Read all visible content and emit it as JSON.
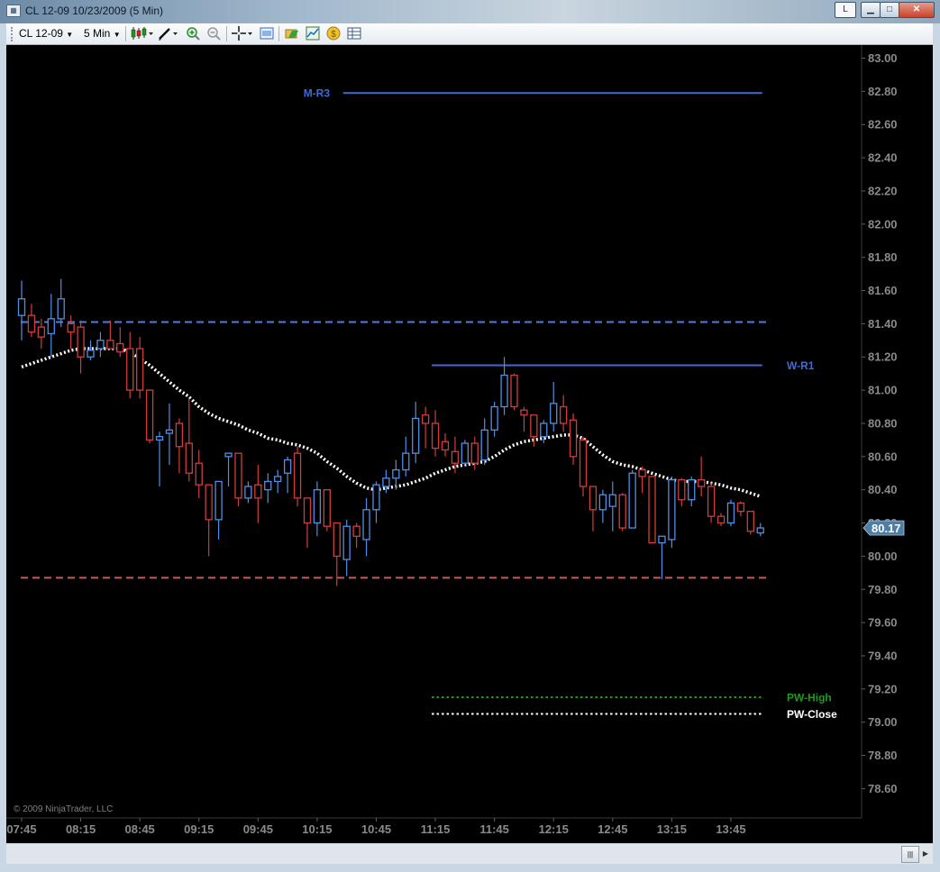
{
  "window": {
    "title": "CL 12-09  10/23/2009 (5 Min)",
    "icon": "chart-window-icon",
    "lock_button": "L"
  },
  "toolbar": {
    "instrument": "CL 12-09",
    "interval": "5 Min",
    "icons": [
      "candlestick-icon",
      "pencil-icon",
      "zoom-in-icon",
      "zoom-out-icon",
      "crosshair-icon",
      "properties-icon",
      "folder-icon",
      "chart-trader-icon",
      "coin-icon",
      "table-icon"
    ]
  },
  "chart": {
    "copyright": "© 2009 NinjaTrader, LLC",
    "last_price_label": "80.17"
  },
  "colors": {
    "background": "#000000",
    "up_candle": "#4f8fe6",
    "down_candle": "#d13d3d",
    "axis_text": "#8a8a8a",
    "resistance_line": "#3e6bd6",
    "support_line": "#c85a5a",
    "pw_high": "#1f9b1f",
    "pw_close": "#ffffff",
    "ma": "#ffffff"
  },
  "chart_data": {
    "type": "candlestick",
    "instrument": "CL 12-09",
    "interval": "5 Min",
    "date": "10/23/2009",
    "ylim": [
      78.5,
      83.05
    ],
    "y_ticks": [
      83.0,
      82.8,
      82.6,
      82.4,
      82.2,
      82.0,
      81.8,
      81.6,
      81.4,
      81.2,
      81.0,
      80.8,
      80.6,
      80.4,
      80.2,
      80.0,
      79.8,
      79.6,
      79.4,
      79.2,
      79.0,
      78.8,
      78.6
    ],
    "x_tick_labels": [
      "07:45",
      "08:15",
      "08:45",
      "09:15",
      "09:45",
      "10:15",
      "10:45",
      "11:15",
      "11:45",
      "12:15",
      "12:45",
      "13:15",
      "13:45"
    ],
    "start_time": "07:45",
    "bar_minutes": 5,
    "last_price": 80.17,
    "candles": [
      {
        "o": 81.45,
        "h": 81.66,
        "l": 81.3,
        "c": 81.55
      },
      {
        "o": 81.45,
        "h": 81.52,
        "l": 81.32,
        "c": 81.35
      },
      {
        "o": 81.38,
        "h": 81.43,
        "l": 81.25,
        "c": 81.32
      },
      {
        "o": 81.34,
        "h": 81.58,
        "l": 81.2,
        "c": 81.43
      },
      {
        "o": 81.43,
        "h": 81.67,
        "l": 81.38,
        "c": 81.55
      },
      {
        "o": 81.4,
        "h": 81.45,
        "l": 81.25,
        "c": 81.35
      },
      {
        "o": 81.38,
        "h": 81.42,
        "l": 81.1,
        "c": 81.2
      },
      {
        "o": 81.2,
        "h": 81.3,
        "l": 81.18,
        "c": 81.24
      },
      {
        "o": 81.25,
        "h": 81.35,
        "l": 81.2,
        "c": 81.3
      },
      {
        "o": 81.3,
        "h": 81.42,
        "l": 81.25,
        "c": 81.25
      },
      {
        "o": 81.28,
        "h": 81.38,
        "l": 81.2,
        "c": 81.23
      },
      {
        "o": 81.25,
        "h": 81.35,
        "l": 80.95,
        "c": 81.0
      },
      {
        "o": 81.25,
        "h": 81.32,
        "l": 80.95,
        "c": 81.0
      },
      {
        "o": 81.0,
        "h": 81.0,
        "l": 80.68,
        "c": 80.7
      },
      {
        "o": 80.7,
        "h": 80.75,
        "l": 80.42,
        "c": 80.72
      },
      {
        "o": 80.74,
        "h": 80.92,
        "l": 80.55,
        "c": 80.76
      },
      {
        "o": 80.8,
        "h": 80.83,
        "l": 80.5,
        "c": 80.66
      },
      {
        "o": 80.68,
        "h": 80.95,
        "l": 80.45,
        "c": 80.5
      },
      {
        "o": 80.56,
        "h": 80.64,
        "l": 80.35,
        "c": 80.43
      },
      {
        "o": 80.43,
        "h": 80.43,
        "l": 80.0,
        "c": 80.22
      },
      {
        "o": 80.22,
        "h": 80.45,
        "l": 80.1,
        "c": 80.45
      },
      {
        "o": 80.6,
        "h": 80.62,
        "l": 80.42,
        "c": 80.62
      },
      {
        "o": 80.62,
        "h": 80.62,
        "l": 80.3,
        "c": 80.35
      },
      {
        "o": 80.35,
        "h": 80.45,
        "l": 80.32,
        "c": 80.42
      },
      {
        "o": 80.43,
        "h": 80.55,
        "l": 80.2,
        "c": 80.35
      },
      {
        "o": 80.4,
        "h": 80.5,
        "l": 80.32,
        "c": 80.45
      },
      {
        "o": 80.45,
        "h": 80.52,
        "l": 80.38,
        "c": 80.48
      },
      {
        "o": 80.5,
        "h": 80.6,
        "l": 80.38,
        "c": 80.58
      },
      {
        "o": 80.62,
        "h": 80.66,
        "l": 80.3,
        "c": 80.35
      },
      {
        "o": 80.35,
        "h": 80.35,
        "l": 80.05,
        "c": 80.2
      },
      {
        "o": 80.2,
        "h": 80.45,
        "l": 80.12,
        "c": 80.4
      },
      {
        "o": 80.4,
        "h": 80.4,
        "l": 80.15,
        "c": 80.18
      },
      {
        "o": 80.2,
        "h": 80.2,
        "l": 79.82,
        "c": 80.0
      },
      {
        "o": 79.98,
        "h": 80.22,
        "l": 79.88,
        "c": 80.18
      },
      {
        "o": 80.18,
        "h": 80.2,
        "l": 80.05,
        "c": 80.12
      },
      {
        "o": 80.1,
        "h": 80.35,
        "l": 80.0,
        "c": 80.28
      },
      {
        "o": 80.28,
        "h": 80.45,
        "l": 80.2,
        "c": 80.43
      },
      {
        "o": 80.42,
        "h": 80.52,
        "l": 80.38,
        "c": 80.47
      },
      {
        "o": 80.47,
        "h": 80.58,
        "l": 80.4,
        "c": 80.52
      },
      {
        "o": 80.52,
        "h": 80.72,
        "l": 80.48,
        "c": 80.62
      },
      {
        "o": 80.62,
        "h": 80.93,
        "l": 80.56,
        "c": 80.83
      },
      {
        "o": 80.85,
        "h": 80.9,
        "l": 80.65,
        "c": 80.8
      },
      {
        "o": 80.8,
        "h": 80.88,
        "l": 80.6,
        "c": 80.65
      },
      {
        "o": 80.69,
        "h": 80.74,
        "l": 80.6,
        "c": 80.64
      },
      {
        "o": 80.63,
        "h": 80.72,
        "l": 80.5,
        "c": 80.56
      },
      {
        "o": 80.56,
        "h": 80.7,
        "l": 80.55,
        "c": 80.68
      },
      {
        "o": 80.68,
        "h": 80.72,
        "l": 80.52,
        "c": 80.56
      },
      {
        "o": 80.58,
        "h": 80.83,
        "l": 80.55,
        "c": 80.76
      },
      {
        "o": 80.76,
        "h": 80.93,
        "l": 80.72,
        "c": 80.9
      },
      {
        "o": 80.9,
        "h": 81.2,
        "l": 80.85,
        "c": 81.09
      },
      {
        "o": 81.09,
        "h": 81.1,
        "l": 80.88,
        "c": 80.9
      },
      {
        "o": 80.88,
        "h": 80.9,
        "l": 80.75,
        "c": 80.85
      },
      {
        "o": 80.85,
        "h": 80.85,
        "l": 80.66,
        "c": 80.72
      },
      {
        "o": 80.72,
        "h": 80.82,
        "l": 80.68,
        "c": 80.8
      },
      {
        "o": 80.8,
        "h": 81.05,
        "l": 80.75,
        "c": 80.92
      },
      {
        "o": 80.9,
        "h": 80.97,
        "l": 80.75,
        "c": 80.8
      },
      {
        "o": 80.82,
        "h": 80.86,
        "l": 80.55,
        "c": 80.6
      },
      {
        "o": 80.7,
        "h": 80.72,
        "l": 80.36,
        "c": 80.42
      },
      {
        "o": 80.42,
        "h": 80.42,
        "l": 80.15,
        "c": 80.28
      },
      {
        "o": 80.28,
        "h": 80.4,
        "l": 80.2,
        "c": 80.37
      },
      {
        "o": 80.3,
        "h": 80.45,
        "l": 80.15,
        "c": 80.37
      },
      {
        "o": 80.37,
        "h": 80.38,
        "l": 80.15,
        "c": 80.17
      },
      {
        "o": 80.17,
        "h": 80.52,
        "l": 80.17,
        "c": 80.5
      },
      {
        "o": 80.52,
        "h": 80.54,
        "l": 80.38,
        "c": 80.48
      },
      {
        "o": 80.48,
        "h": 80.48,
        "l": 80.08,
        "c": 80.08
      },
      {
        "o": 80.08,
        "h": 80.12,
        "l": 79.86,
        "c": 80.12
      },
      {
        "o": 80.1,
        "h": 80.48,
        "l": 80.05,
        "c": 80.46
      },
      {
        "o": 80.46,
        "h": 80.47,
        "l": 80.3,
        "c": 80.34
      },
      {
        "o": 80.34,
        "h": 80.48,
        "l": 80.3,
        "c": 80.46
      },
      {
        "o": 80.46,
        "h": 80.6,
        "l": 80.36,
        "c": 80.42
      },
      {
        "o": 80.42,
        "h": 80.44,
        "l": 80.2,
        "c": 80.24
      },
      {
        "o": 80.24,
        "h": 80.26,
        "l": 80.18,
        "c": 80.2
      },
      {
        "o": 80.2,
        "h": 80.34,
        "l": 80.18,
        "c": 80.32
      },
      {
        "o": 80.32,
        "h": 80.33,
        "l": 80.24,
        "c": 80.27
      },
      {
        "o": 80.27,
        "h": 80.27,
        "l": 80.13,
        "c": 80.15
      },
      {
        "o": 80.14,
        "h": 80.2,
        "l": 80.12,
        "c": 80.17
      }
    ],
    "moving_average": [
      81.14,
      81.16,
      81.18,
      81.2,
      81.22,
      81.24,
      81.25,
      81.25,
      81.25,
      81.25,
      81.25,
      81.23,
      81.19,
      81.15,
      81.1,
      81.05,
      81.0,
      80.96,
      80.9,
      80.86,
      80.83,
      80.81,
      80.79,
      80.76,
      80.74,
      80.71,
      80.7,
      80.68,
      80.67,
      80.65,
      80.62,
      80.57,
      80.53,
      80.48,
      80.44,
      80.41,
      80.4,
      80.41,
      80.42,
      80.43,
      80.45,
      80.47,
      80.5,
      80.52,
      80.54,
      80.55,
      80.56,
      80.57,
      80.6,
      80.64,
      80.67,
      80.69,
      80.7,
      80.71,
      80.72,
      80.73,
      80.73,
      80.71,
      80.66,
      80.61,
      80.57,
      80.55,
      80.54,
      80.52,
      80.5,
      80.48,
      80.46,
      80.45,
      80.45,
      80.45,
      80.44,
      80.43,
      80.41,
      80.4,
      80.38,
      80.36
    ],
    "levels": [
      {
        "name": "M-R3",
        "value": 82.79,
        "style": "solid",
        "color": "#3e6bd6",
        "start_time": "10:30"
      },
      {
        "name": "",
        "value": 81.41,
        "style": "dashed",
        "color": "#4a7ee8",
        "start_time": "07:45"
      },
      {
        "name": "W-R1",
        "value": 81.15,
        "style": "solid",
        "color": "#3e6bd6",
        "start_time": "11:15"
      },
      {
        "name": "",
        "value": 79.87,
        "style": "dashed",
        "color": "#c85a5a",
        "start_time": "07:45"
      },
      {
        "name": "PW-High",
        "value": 79.15,
        "style": "dotted",
        "color": "#1f9b1f",
        "start_time": "11:15"
      },
      {
        "name": "PW-Close",
        "value": 79.05,
        "style": "dotted",
        "color": "#ffffff",
        "start_time": "11:15"
      }
    ]
  }
}
